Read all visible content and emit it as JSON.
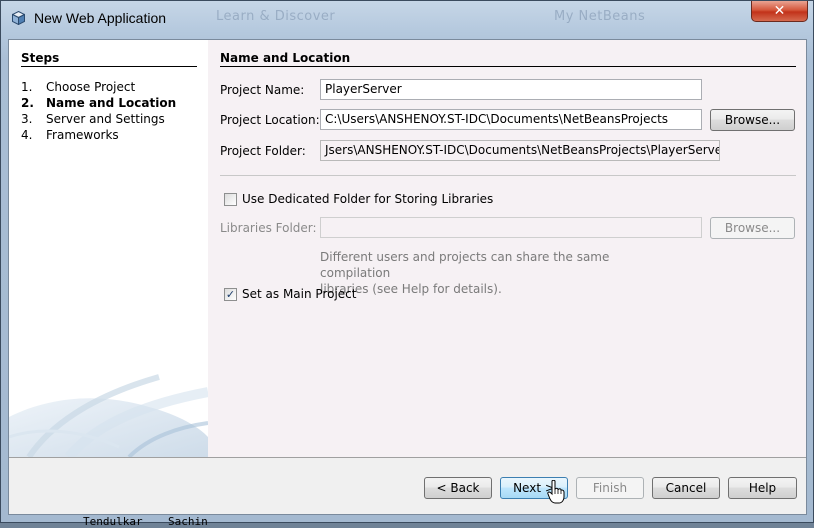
{
  "window": {
    "title": "New Web Application",
    "close_glyph": "✕",
    "background_tabs": [
      "Learn & Discover",
      "My NetBeans"
    ],
    "underlying_text": [
      "Tendulkar",
      "Sachin"
    ]
  },
  "steps": {
    "title": "Steps",
    "current_index": 1,
    "items": [
      {
        "num": "1.",
        "label": "Choose Project"
      },
      {
        "num": "2.",
        "label": "Name and Location"
      },
      {
        "num": "3.",
        "label": "Server and Settings"
      },
      {
        "num": "4.",
        "label": "Frameworks"
      }
    ]
  },
  "main": {
    "section_title": "Name and Location",
    "project_name": {
      "label": "Project Name:",
      "value": "PlayerServer"
    },
    "project_location": {
      "label": "Project Location:",
      "value": "C:\\Users\\ANSHENOY.ST-IDC\\Documents\\NetBeansProjects",
      "browse_label": "Browse..."
    },
    "project_folder": {
      "label": "Project Folder:",
      "value": "Jsers\\ANSHENOY.ST-IDC\\Documents\\NetBeansProjects\\PlayerServer"
    },
    "dedicated_folder": {
      "label": "Use Dedicated Folder for Storing Libraries",
      "checked": false
    },
    "libraries_folder": {
      "label": "Libraries Folder:",
      "value": "",
      "browse_label": "Browse...",
      "enabled": false
    },
    "help_text_1": "Different users and projects can share the same compilation",
    "help_text_2": "libraries (see Help for details).",
    "main_project": {
      "label": "Set as Main Project",
      "checked": true
    }
  },
  "footer": {
    "back_label": "< Back",
    "next_label": "Next >",
    "finish_label": "Finish",
    "cancel_label": "Cancel",
    "help_label": "Help"
  },
  "icons": {
    "app_icon": "netbeans-cube-icon",
    "cursor": "mouse-pointer-icon",
    "check": "✓"
  },
  "colors": {
    "title_bar": "#b5c9de",
    "close_button": "#c2321a",
    "content_bg": "#f6f1f4",
    "default_button": "#bee6fd"
  }
}
